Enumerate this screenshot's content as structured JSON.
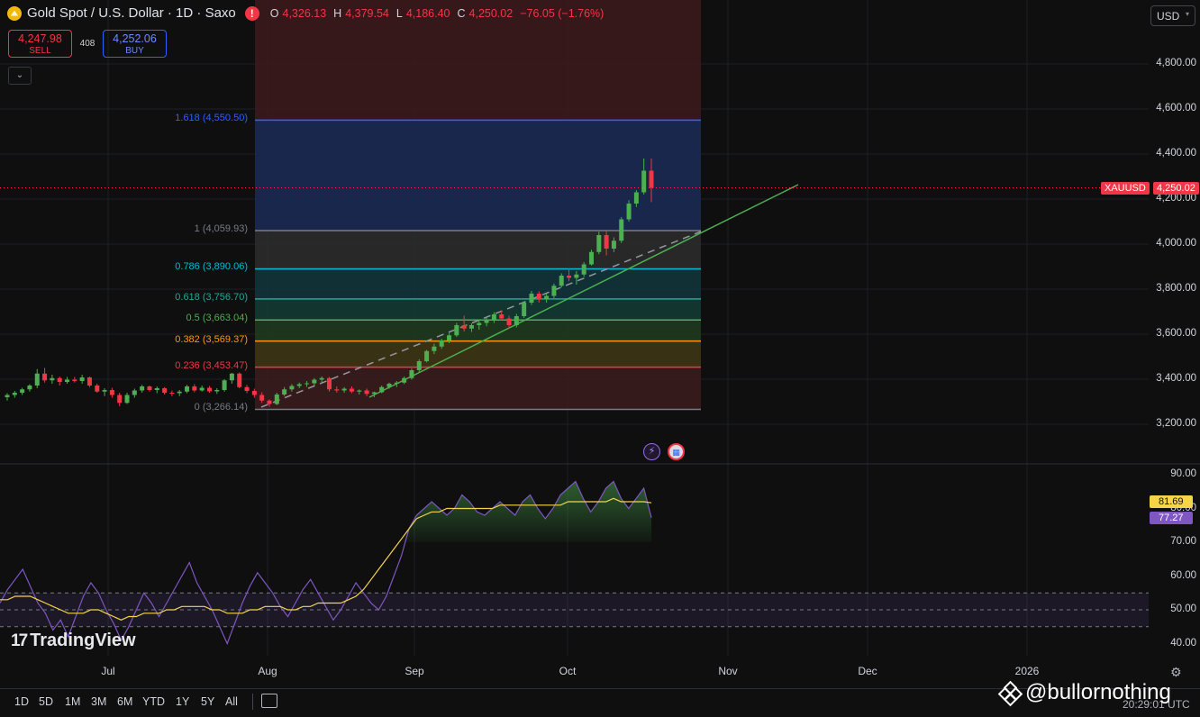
{
  "header": {
    "title": "Gold Spot / U.S. Dollar · 1D · Saxo",
    "ohlc": [
      {
        "k": "O",
        "v": "4,326.13"
      },
      {
        "k": "H",
        "v": "4,379.54"
      },
      {
        "k": "L",
        "v": "4,186.40"
      },
      {
        "k": "C",
        "v": "4,250.02"
      },
      {
        "k": "",
        "v": "−76.05 (−1.76%)"
      }
    ]
  },
  "trade": {
    "sell_price": "4,247.98",
    "sell_label": "SELL",
    "spread": "408",
    "buy_price": "4,252.06",
    "buy_label": "BUY"
  },
  "currency": "USD",
  "symbol_badge": "XAUUSD",
  "last_price": "4,250.02",
  "price_axis": [
    "4,800.00",
    "4,600.00",
    "4,400.00",
    "4,200.00",
    "4,000.00",
    "3,800.00",
    "3,600.00",
    "3,400.00",
    "3,200.00"
  ],
  "rsi_axis": [
    "90.00",
    "80.00",
    "70.00",
    "60.00",
    "50.00",
    "40.00"
  ],
  "rsi_badges": {
    "ma": "81.69",
    "rsi": "77.27"
  },
  "time_axis": [
    "Jul",
    "Aug",
    "Sep",
    "Oct",
    "Nov",
    "Dec",
    "2026"
  ],
  "timeframes": [
    "1D",
    "5D",
    "1M",
    "3M",
    "6M",
    "YTD",
    "1Y",
    "5Y",
    "All"
  ],
  "timestamp": "20:29:01 UTC",
  "watermark": "@bullornothing",
  "brand": "TradingView",
  "colors": {
    "up": "#4caf50",
    "down": "#f23645",
    "fib_blue": "#2962ff",
    "accent": "#f0b90b"
  },
  "chart_data": {
    "type": "candlestick",
    "title": "Gold Spot / U.S. Dollar · 1D · Saxo",
    "ylim": [
      3100,
      4950
    ],
    "candles": [
      [
        3320,
        3338,
        3305,
        3330
      ],
      [
        3330,
        3348,
        3318,
        3340
      ],
      [
        3340,
        3362,
        3330,
        3355
      ],
      [
        3355,
        3378,
        3345,
        3372
      ],
      [
        3372,
        3445,
        3360,
        3425
      ],
      [
        3425,
        3450,
        3385,
        3395
      ],
      [
        3395,
        3420,
        3380,
        3405
      ],
      [
        3405,
        3412,
        3372,
        3388
      ],
      [
        3388,
        3410,
        3380,
        3398
      ],
      [
        3398,
        3410,
        3385,
        3392
      ],
      [
        3392,
        3420,
        3380,
        3408
      ],
      [
        3408,
        3412,
        3365,
        3372
      ],
      [
        3372,
        3380,
        3340,
        3345
      ],
      [
        3345,
        3360,
        3325,
        3352
      ],
      [
        3352,
        3362,
        3318,
        3330
      ],
      [
        3330,
        3340,
        3280,
        3295
      ],
      [
        3295,
        3340,
        3290,
        3330
      ],
      [
        3330,
        3358,
        3318,
        3350
      ],
      [
        3350,
        3375,
        3340,
        3368
      ],
      [
        3368,
        3372,
        3345,
        3352
      ],
      [
        3352,
        3368,
        3338,
        3360
      ],
      [
        3360,
        3365,
        3332,
        3340
      ],
      [
        3340,
        3350,
        3325,
        3338
      ],
      [
        3338,
        3352,
        3325,
        3345
      ],
      [
        3345,
        3375,
        3338,
        3368
      ],
      [
        3368,
        3378,
        3342,
        3350
      ],
      [
        3350,
        3372,
        3345,
        3362
      ],
      [
        3362,
        3370,
        3340,
        3346
      ],
      [
        3346,
        3360,
        3335,
        3352
      ],
      [
        3352,
        3400,
        3345,
        3395
      ],
      [
        3395,
        3428,
        3380,
        3425
      ],
      [
        3425,
        3430,
        3360,
        3365
      ],
      [
        3365,
        3375,
        3338,
        3348
      ],
      [
        3348,
        3358,
        3318,
        3330
      ],
      [
        3330,
        3342,
        3295,
        3305
      ],
      [
        3305,
        3310,
        3278,
        3290
      ],
      [
        3290,
        3340,
        3285,
        3332
      ],
      [
        3332,
        3365,
        3325,
        3355
      ],
      [
        3355,
        3378,
        3345,
        3370
      ],
      [
        3370,
        3385,
        3360,
        3378
      ],
      [
        3378,
        3392,
        3366,
        3382
      ],
      [
        3382,
        3405,
        3372,
        3398
      ],
      [
        3398,
        3412,
        3385,
        3405
      ],
      [
        3405,
        3410,
        3345,
        3355
      ],
      [
        3355,
        3368,
        3340,
        3350
      ],
      [
        3350,
        3365,
        3340,
        3358
      ],
      [
        3358,
        3368,
        3338,
        3345
      ],
      [
        3345,
        3355,
        3332,
        3350
      ],
      [
        3350,
        3358,
        3325,
        3335
      ],
      [
        3335,
        3345,
        3320,
        3342
      ],
      [
        3342,
        3372,
        3338,
        3365
      ],
      [
        3365,
        3385,
        3358,
        3380
      ],
      [
        3380,
        3392,
        3365,
        3385
      ],
      [
        3385,
        3412,
        3378,
        3405
      ],
      [
        3405,
        3448,
        3398,
        3440
      ],
      [
        3440,
        3488,
        3432,
        3480
      ],
      [
        3480,
        3530,
        3475,
        3525
      ],
      [
        3525,
        3558,
        3512,
        3545
      ],
      [
        3545,
        3580,
        3535,
        3572
      ],
      [
        3572,
        3605,
        3560,
        3595
      ],
      [
        3595,
        3650,
        3588,
        3640
      ],
      [
        3640,
        3682,
        3612,
        3625
      ],
      [
        3625,
        3648,
        3610,
        3640
      ],
      [
        3640,
        3662,
        3620,
        3650
      ],
      [
        3650,
        3672,
        3635,
        3660
      ],
      [
        3660,
        3698,
        3650,
        3688
      ],
      [
        3688,
        3705,
        3660,
        3670
      ],
      [
        3670,
        3682,
        3625,
        3640
      ],
      [
        3640,
        3690,
        3630,
        3680
      ],
      [
        3680,
        3745,
        3672,
        3740
      ],
      [
        3740,
        3792,
        3730,
        3780
      ],
      [
        3780,
        3790,
        3740,
        3755
      ],
      [
        3755,
        3780,
        3740,
        3770
      ],
      [
        3770,
        3825,
        3760,
        3815
      ],
      [
        3815,
        3870,
        3808,
        3860
      ],
      [
        3860,
        3892,
        3835,
        3850
      ],
      [
        3850,
        3880,
        3820,
        3865
      ],
      [
        3865,
        3920,
        3855,
        3910
      ],
      [
        3910,
        3975,
        3905,
        3965
      ],
      [
        3965,
        4055,
        3955,
        4040
      ],
      [
        4040,
        4060,
        3950,
        3980
      ],
      [
        3980,
        4030,
        3965,
        4015
      ],
      [
        4015,
        4120,
        4005,
        4110
      ],
      [
        4110,
        4195,
        4100,
        4180
      ],
      [
        4180,
        4240,
        4165,
        4230
      ],
      [
        4230,
        4380,
        4220,
        4326
      ],
      [
        4326,
        4379.54,
        4186.4,
        4250.02
      ]
    ],
    "fibonacci": [
      {
        "level": "1.618 (4,550.50)",
        "price": 4550.5,
        "color": "#2962ff"
      },
      {
        "level": "1 (4,059.93)",
        "price": 4059.93,
        "color": "#787b86"
      },
      {
        "level": "0.786 (3,890.06)",
        "price": 3890.06,
        "color": "#00bcd4"
      },
      {
        "level": "0.618 (3,756.70)",
        "price": 3756.7,
        "color": "#26a69a"
      },
      {
        "level": "0.5 (3,663.04)",
        "price": 3663.04,
        "color": "#4caf50"
      },
      {
        "level": "0.382 (3,569.37)",
        "price": 3569.37,
        "color": "#ff9800"
      },
      {
        "level": "0.236 (3,453.47)",
        "price": 3453.47,
        "color": "#f23645"
      },
      {
        "level": "0 (3,266.14)",
        "price": 3266.14,
        "color": "#787b86"
      }
    ],
    "rsi": [
      52,
      56,
      59,
      62,
      57,
      52,
      49,
      44,
      47,
      42,
      48,
      54,
      58,
      55,
      50,
      46,
      41,
      45,
      50,
      55,
      52,
      48,
      52,
      56,
      60,
      64,
      58,
      54,
      50,
      45,
      40,
      46,
      52,
      57,
      61,
      58,
      55,
      51,
      48,
      52,
      56,
      59,
      55,
      51,
      47,
      50,
      54,
      58,
      55,
      52,
      50,
      54,
      60,
      66,
      74,
      78,
      80,
      82,
      80,
      78,
      80,
      84,
      82,
      79,
      78,
      80,
      82,
      80,
      78,
      82,
      84,
      80,
      77,
      80,
      84,
      86,
      88,
      83,
      79,
      82,
      86,
      88,
      83,
      80,
      83,
      86,
      77.27
    ],
    "rsi_ma": [
      53,
      53,
      54,
      54,
      54,
      53,
      52,
      51,
      50,
      49,
      49,
      49,
      50,
      50,
      49,
      48,
      47,
      48,
      48,
      49,
      49,
      49,
      50,
      50,
      51,
      51,
      51,
      51,
      50,
      50,
      49,
      49,
      49,
      50,
      50,
      51,
      51,
      51,
      50,
      50,
      51,
      51,
      52,
      52,
      52,
      52,
      53,
      54,
      56,
      59,
      62,
      65,
      68,
      71,
      74,
      77,
      78,
      79,
      79,
      80,
      80,
      80,
      80,
      80,
      80,
      80,
      81,
      81,
      81,
      81,
      81,
      81,
      81,
      81,
      81,
      82,
      82,
      82,
      82,
      82,
      82,
      83,
      82,
      82,
      82,
      82,
      81.69
    ]
  }
}
